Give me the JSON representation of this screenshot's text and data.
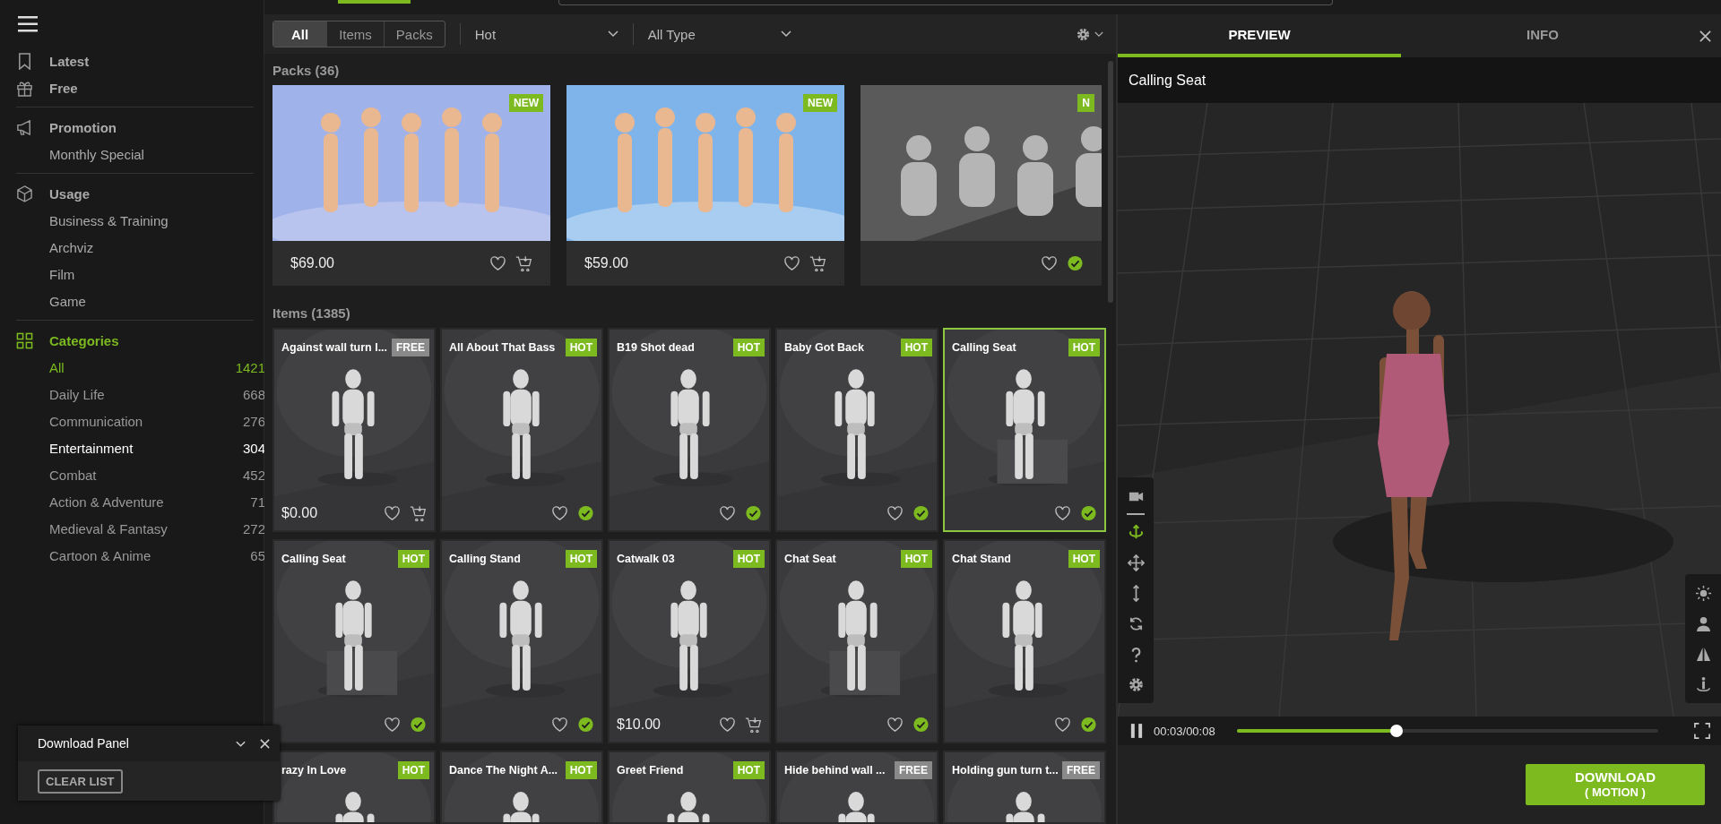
{
  "sidebar": {
    "top_items": [
      {
        "label": "Latest"
      },
      {
        "label": "Free"
      }
    ],
    "sections": [
      {
        "title": "Promotion",
        "items": [
          {
            "label": "Monthly Special"
          }
        ]
      },
      {
        "title": "Usage",
        "items": [
          {
            "label": "Business & Training"
          },
          {
            "label": "Archviz"
          },
          {
            "label": "Film"
          },
          {
            "label": "Game"
          }
        ]
      }
    ],
    "categories": {
      "title": "Categories",
      "items": [
        {
          "label": "All",
          "count": "1421",
          "selected": true,
          "hovered": false
        },
        {
          "label": "Daily Life",
          "count": "668",
          "selected": false,
          "hovered": false
        },
        {
          "label": "Communication",
          "count": "276",
          "selected": false,
          "hovered": false
        },
        {
          "label": "Entertainment",
          "count": "304",
          "selected": false,
          "hovered": true
        },
        {
          "label": "Combat",
          "count": "452",
          "selected": false,
          "hovered": false
        },
        {
          "label": "Action & Adventure",
          "count": "71",
          "selected": false,
          "hovered": false
        },
        {
          "label": "Medieval & Fantasy",
          "count": "272",
          "selected": false,
          "hovered": false
        },
        {
          "label": "Cartoon & Anime",
          "count": "65",
          "selected": false,
          "hovered": false
        }
      ]
    }
  },
  "download_panel": {
    "title": "Download Panel",
    "button": "CLEAR LIST"
  },
  "filter_bar": {
    "segments": [
      {
        "label": "All",
        "selected": true
      },
      {
        "label": "Items",
        "selected": false
      },
      {
        "label": "Packs",
        "selected": false
      }
    ],
    "sort": "Hot",
    "type": "All Type"
  },
  "packs": {
    "title": "Packs (36)",
    "items": [
      {
        "kind": "picture",
        "badge": "NEW",
        "price": "$69.00",
        "owned": false
      },
      {
        "kind": "picture",
        "badge": "NEW",
        "price": "$59.00",
        "owned": false
      },
      {
        "kind": "picture",
        "badge": "N",
        "owned": true
      }
    ]
  },
  "items": {
    "title": "Items (1385)",
    "cards": [
      {
        "name": "Against wall turn l...",
        "badge": {
          "text": "FREE",
          "kind": "free"
        },
        "price": "$0.00",
        "owned": false,
        "selected": false
      },
      {
        "name": "All About That Bass",
        "badge": {
          "text": "HOT",
          "kind": "hot"
        },
        "owned": true,
        "selected": false
      },
      {
        "name": "B19 Shot dead",
        "badge": {
          "text": "HOT",
          "kind": "hot"
        },
        "owned": true,
        "selected": false
      },
      {
        "name": "Baby Got Back",
        "badge": {
          "text": "HOT",
          "kind": "hot"
        },
        "owned": true,
        "selected": false
      },
      {
        "name": "Calling Seat",
        "badge": {
          "text": "HOT",
          "kind": "hot"
        },
        "owned": true,
        "selected": true
      },
      {
        "name": "Calling Seat",
        "badge": {
          "text": "HOT",
          "kind": "hot"
        },
        "owned": true,
        "selected": false
      },
      {
        "name": "Calling Stand",
        "badge": {
          "text": "HOT",
          "kind": "hot"
        },
        "owned": true,
        "selected": false
      },
      {
        "name": "Catwalk 03",
        "badge": {
          "text": "HOT",
          "kind": "hot"
        },
        "price": "$10.00",
        "owned": false,
        "selected": false
      },
      {
        "name": "Chat Seat",
        "badge": {
          "text": "HOT",
          "kind": "hot"
        },
        "owned": true,
        "selected": false
      },
      {
        "name": "Chat Stand",
        "badge": {
          "text": "HOT",
          "kind": "hot"
        },
        "owned": true,
        "selected": false
      },
      {
        "name": "razy In Love",
        "badge": {
          "text": "HOT",
          "kind": "hot"
        },
        "selected": false
      },
      {
        "name": "Dance The Night A...",
        "badge": {
          "text": "HOT",
          "kind": "hot"
        },
        "selected": false
      },
      {
        "name": "Greet Friend",
        "badge": {
          "text": "HOT",
          "kind": "hot"
        },
        "selected": false
      },
      {
        "name": "Hide behind wall ...",
        "badge": {
          "text": "FREE",
          "kind": "free"
        },
        "selected": false
      },
      {
        "name": "Holding gun turn t...",
        "badge": {
          "text": "FREE",
          "kind": "free"
        },
        "selected": false
      }
    ]
  },
  "preview": {
    "tabs": [
      {
        "label": "PREVIEW",
        "selected": true
      },
      {
        "label": "INFO",
        "selected": false
      }
    ],
    "title": "Calling Seat",
    "tools": [
      {
        "selected": false
      },
      {
        "selected": true
      },
      {
        "selected": false
      },
      {
        "selected": false
      },
      {
        "selected": false
      },
      {
        "selected": false
      },
      {
        "selected": false
      }
    ],
    "player": {
      "playing": true,
      "time": "00:03/00:08",
      "level": 0.38
    },
    "download_button": {
      "label": "DOWNLOAD",
      "sub": "( MOTION )"
    }
  }
}
